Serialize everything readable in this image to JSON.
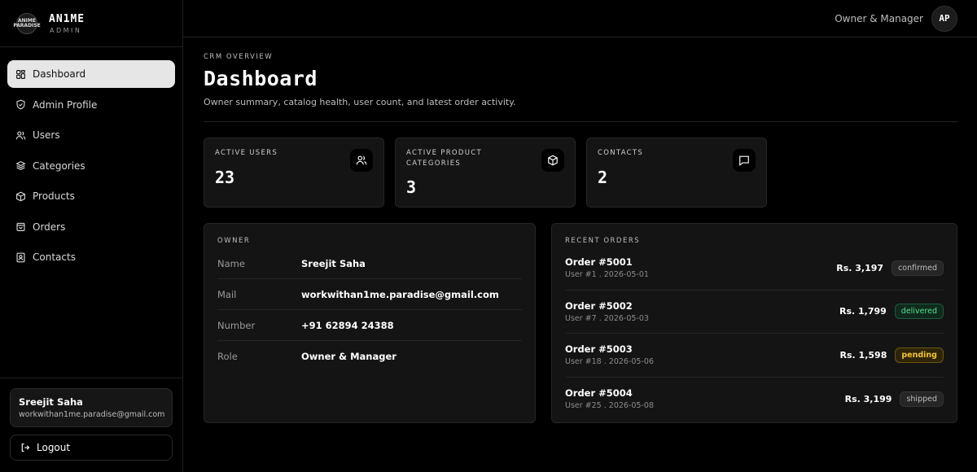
{
  "brand": {
    "logo_text": "ANIME PARADISE",
    "name": "AN1ME",
    "sub": "ADMIN"
  },
  "nav": [
    {
      "label": "Dashboard",
      "icon": "dashboard-icon",
      "active": true
    },
    {
      "label": "Admin Profile",
      "icon": "shield-icon"
    },
    {
      "label": "Users",
      "icon": "users-icon"
    },
    {
      "label": "Categories",
      "icon": "layers-icon"
    },
    {
      "label": "Products",
      "icon": "box-icon"
    },
    {
      "label": "Orders",
      "icon": "bag-icon"
    },
    {
      "label": "Contacts",
      "icon": "contact-icon"
    }
  ],
  "sidebar_user": {
    "name": "Sreejit Saha",
    "email": "workwithan1me.paradise@gmail.com"
  },
  "logout_label": "Logout",
  "topbar": {
    "role": "Owner & Manager",
    "avatar": "AP"
  },
  "header": {
    "eyebrow": "CRM OVERVIEW",
    "title": "Dashboard",
    "subtitle": "Owner summary, catalog health, user count, and latest order activity."
  },
  "stats": [
    {
      "label": "ACTIVE USERS",
      "value": "23",
      "icon": "users-icon"
    },
    {
      "label": "ACTIVE PRODUCT CATEGORIES",
      "value": "3",
      "icon": "box-icon"
    },
    {
      "label": "CONTACTS",
      "value": "2",
      "icon": "message-icon"
    }
  ],
  "owner": {
    "title": "OWNER",
    "rows": [
      {
        "key": "Name",
        "value": "Sreejit Saha"
      },
      {
        "key": "Mail",
        "value": "workwithan1me.paradise@gmail.com"
      },
      {
        "key": "Number",
        "value": "+91 62894 24388"
      },
      {
        "key": "Role",
        "value": "Owner & Manager"
      }
    ]
  },
  "recent_orders": {
    "title": "RECENT ORDERS",
    "orders": [
      {
        "id": "Order #5001",
        "meta": "User #1 . 2026-05-01",
        "amount": "Rs. 3,197",
        "status": "confirmed"
      },
      {
        "id": "Order #5002",
        "meta": "User #7 . 2026-05-03",
        "amount": "Rs. 1,799",
        "status": "delivered"
      },
      {
        "id": "Order #5003",
        "meta": "User #18 . 2026-05-06",
        "amount": "Rs. 1,598",
        "status": "pending"
      },
      {
        "id": "Order #5004",
        "meta": "User #25 . 2026-05-08",
        "amount": "Rs. 3,199",
        "status": "shipped"
      }
    ]
  },
  "colors": {
    "background": "#000000",
    "card": "#141414",
    "delivered": "#4ee28f",
    "pending": "#f3c433"
  }
}
